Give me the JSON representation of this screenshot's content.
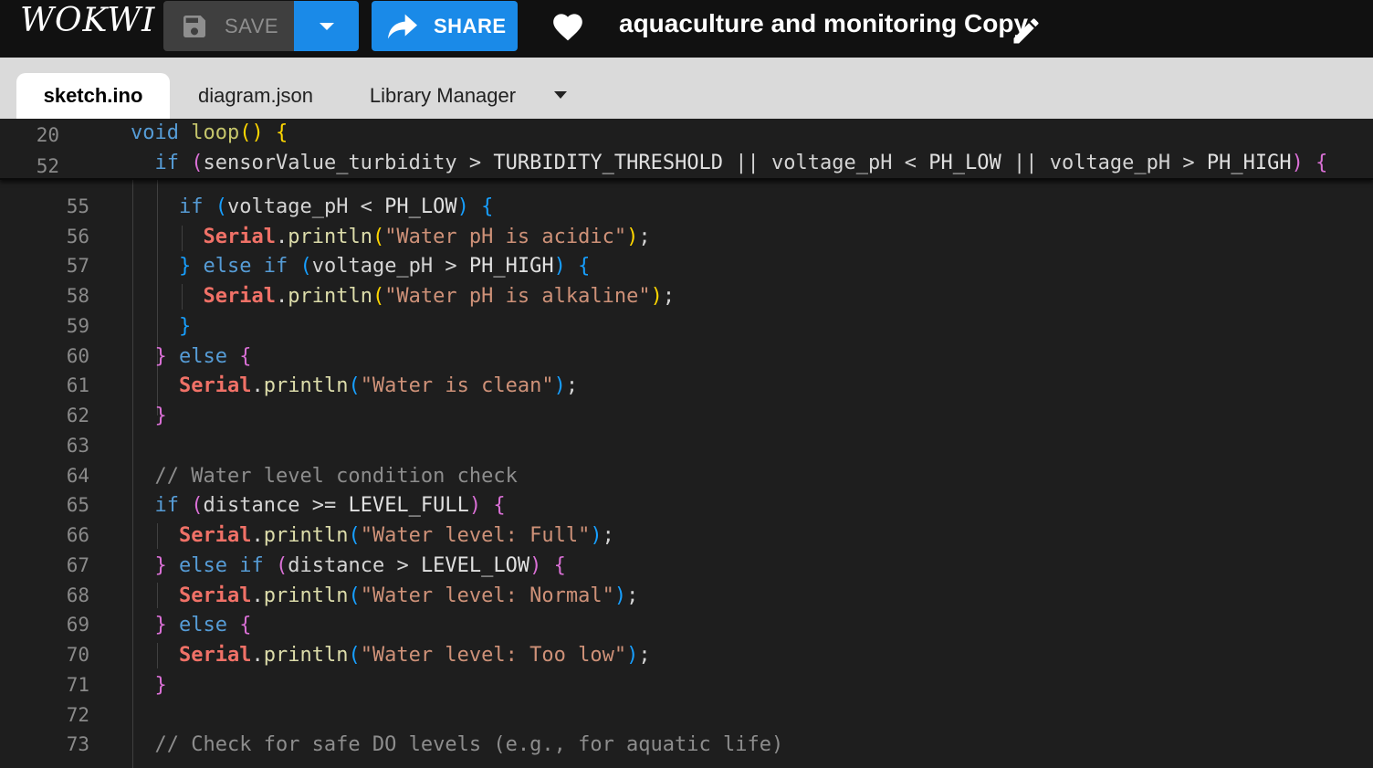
{
  "header": {
    "logo_text": "WOKWI",
    "save_label": "SAVE",
    "share_label": "SHARE",
    "project_title": "aquaculture and monitoring Copy"
  },
  "tabs": [
    {
      "label": "sketch.ino",
      "active": true
    },
    {
      "label": "diagram.json",
      "active": false
    },
    {
      "label": "Library Manager",
      "active": false
    }
  ],
  "sticky": [
    {
      "num": "20",
      "code": "void loop() {"
    },
    {
      "num": "52",
      "code": "  if (sensorValue_turbidity > TURBIDITY_THRESHOLD || voltage_pH < PH_LOW || voltage_pH > PH_HIGH) {"
    }
  ],
  "lines": [
    {
      "num": "55",
      "code": "    if (voltage_pH < PH_LOW) {"
    },
    {
      "num": "56",
      "code": "      Serial.println(\"Water pH is acidic\");"
    },
    {
      "num": "57",
      "code": "    } else if (voltage_pH > PH_HIGH) {"
    },
    {
      "num": "58",
      "code": "      Serial.println(\"Water pH is alkaline\");"
    },
    {
      "num": "59",
      "code": "    }"
    },
    {
      "num": "60",
      "code": "  } else {"
    },
    {
      "num": "61",
      "code": "    Serial.println(\"Water is clean\");"
    },
    {
      "num": "62",
      "code": "  }"
    },
    {
      "num": "63",
      "code": ""
    },
    {
      "num": "64",
      "code": "  // Water level condition check"
    },
    {
      "num": "65",
      "code": "  if (distance >= LEVEL_FULL) {"
    },
    {
      "num": "66",
      "code": "    Serial.println(\"Water level: Full\");"
    },
    {
      "num": "67",
      "code": "  } else if (distance > LEVEL_LOW) {"
    },
    {
      "num": "68",
      "code": "    Serial.println(\"Water level: Normal\");"
    },
    {
      "num": "69",
      "code": "  } else {"
    },
    {
      "num": "70",
      "code": "    Serial.println(\"Water level: Too low\");"
    },
    {
      "num": "71",
      "code": "  }"
    },
    {
      "num": "72",
      "code": ""
    },
    {
      "num": "73",
      "code": "  // Check for safe DO levels (e.g., for aquatic life)"
    }
  ],
  "colors": {
    "accent": "#1a8ae8",
    "topbar": "#111111",
    "editor_bg": "#1e1e1e"
  },
  "icons": [
    "floppy-disk-icon",
    "chevron-down-icon",
    "share-arrow-icon",
    "heart-icon",
    "pencil-icon",
    "tab-menu-caret-icon"
  ]
}
